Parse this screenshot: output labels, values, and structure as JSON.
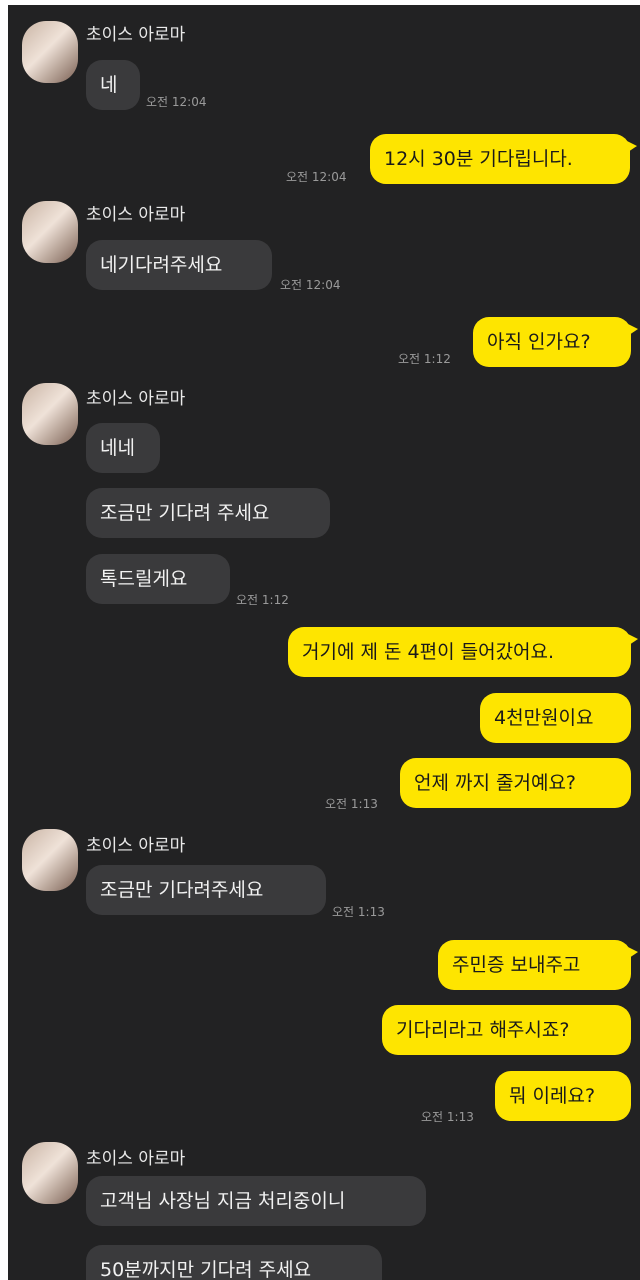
{
  "sender_name": "초이스 아로마",
  "messages": [
    {
      "text": "네",
      "time": "오전 12:04"
    },
    {
      "text": "12시 30분 기다립니다.",
      "time": "오전 12:04"
    },
    {
      "text": "네기다려주세요",
      "time": "오전 12:04"
    },
    {
      "text": "아직 인가요?",
      "time": "오전 1:12"
    },
    {
      "text": "네네"
    },
    {
      "text": "조금만 기다려 주세요"
    },
    {
      "text": "톡드릴게요",
      "time": "오전 1:12"
    },
    {
      "text": "거기에 제 돈 4편이 들어갔어요."
    },
    {
      "text": "4천만원이요"
    },
    {
      "text": "언제 까지 줄거예요?",
      "time": "오전 1:13"
    },
    {
      "text": "조금만 기다려주세요",
      "time": "오전 1:13"
    },
    {
      "text": "주민증 보내주고"
    },
    {
      "text": "기다리라고 해주시죠?"
    },
    {
      "text": "뭐 이레요?",
      "time": "오전 1:13"
    },
    {
      "text": "고객님 사장님 지금 처리중이니"
    },
    {
      "text": "50분까지만 기다려 주세요"
    }
  ]
}
